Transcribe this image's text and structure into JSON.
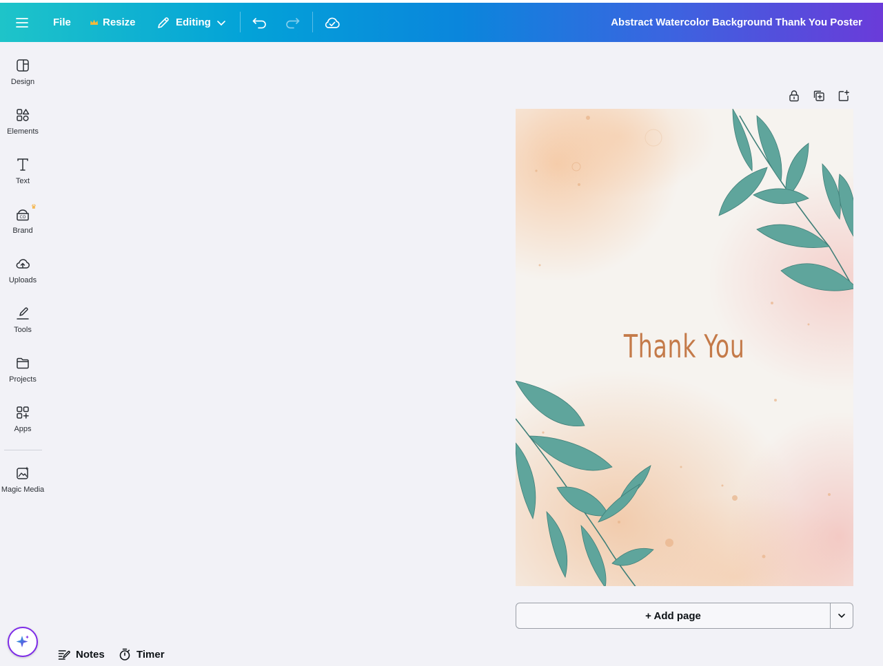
{
  "topbar": {
    "file_label": "File",
    "resize_label": "Resize",
    "editing_label": "Editing",
    "document_title": "Abstract Watercolor Background Thank You Poster"
  },
  "sidebar": {
    "items": [
      {
        "label": "Design",
        "icon": "design-icon"
      },
      {
        "label": "Elements",
        "icon": "elements-icon"
      },
      {
        "label": "Text",
        "icon": "text-icon"
      },
      {
        "label": "Brand",
        "icon": "brand-icon"
      },
      {
        "label": "Uploads",
        "icon": "uploads-icon"
      },
      {
        "label": "Tools",
        "icon": "tools-icon"
      },
      {
        "label": "Projects",
        "icon": "projects-icon"
      },
      {
        "label": "Apps",
        "icon": "apps-icon"
      },
      {
        "label": "Magic Media",
        "icon": "magic-media-icon"
      }
    ]
  },
  "poster": {
    "text": "Thank You"
  },
  "canvas": {
    "add_page_label": "+ Add page"
  },
  "footer": {
    "notes_label": "Notes",
    "timer_label": "Timer"
  },
  "colors": {
    "accent": "#7d2ae8",
    "topbar_start": "#1ec4c9",
    "topbar_end": "#6a3bd9",
    "poster_text": "#c47a49",
    "leaf": "#4f9a92"
  }
}
